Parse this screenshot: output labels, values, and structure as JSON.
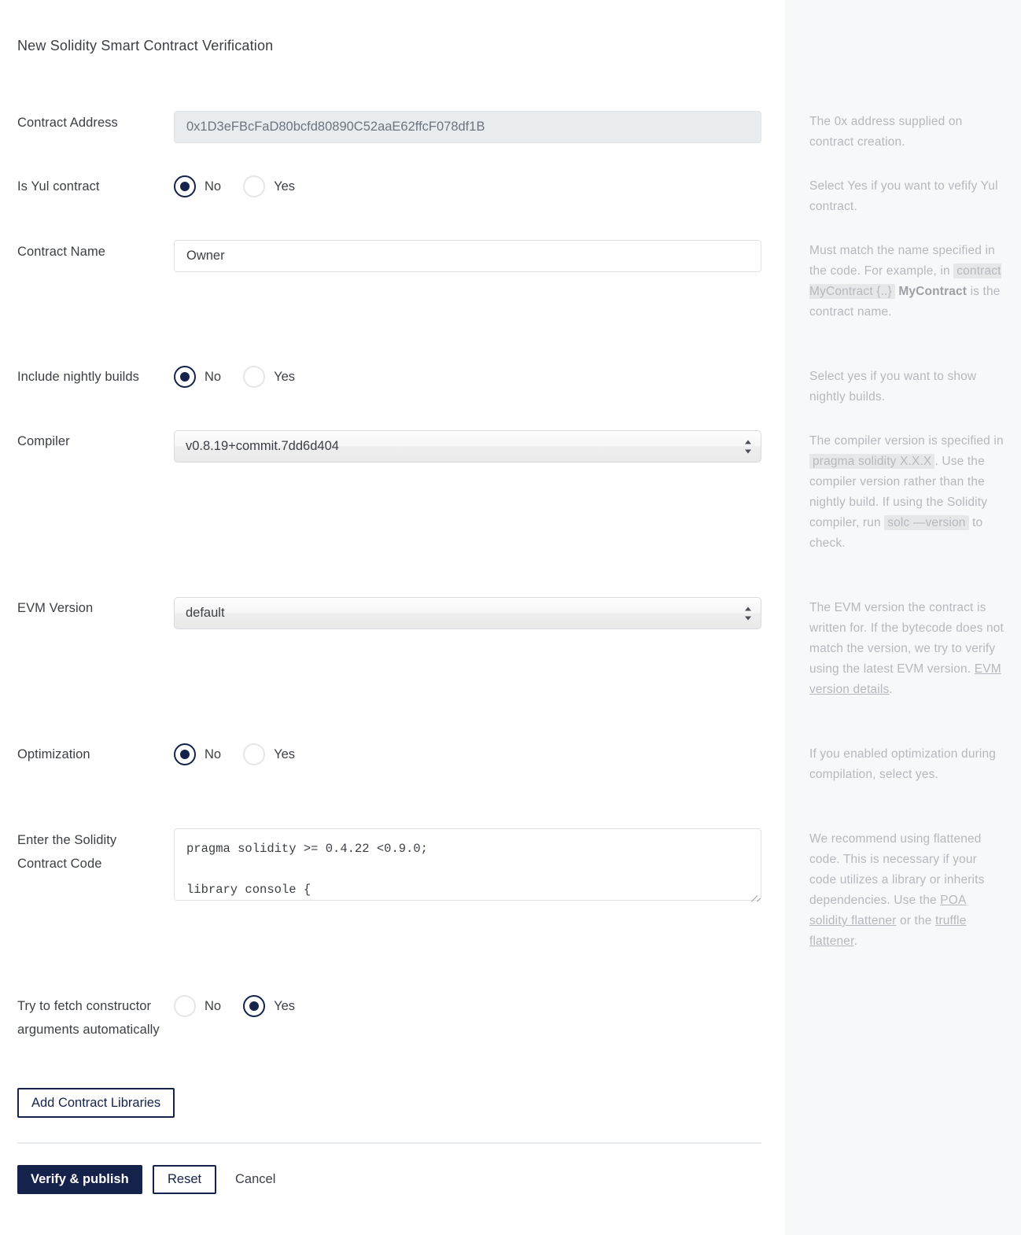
{
  "page": {
    "title": "New Solidity Smart Contract Verification"
  },
  "fields": {
    "contract_address": {
      "label": "Contract Address",
      "value": "0x1D3eFBcFaD80bcfd80890C52aaE62ffcF078df1B"
    },
    "is_yul": {
      "label": "Is Yul contract",
      "no": "No",
      "yes": "Yes",
      "selected": "No"
    },
    "contract_name": {
      "label": "Contract Name",
      "value": "Owner"
    },
    "nightly_builds": {
      "label": "Include nightly builds",
      "no": "No",
      "yes": "Yes",
      "selected": "No"
    },
    "compiler": {
      "label": "Compiler",
      "value": "v0.8.19+commit.7dd6d404"
    },
    "evm_version": {
      "label": "EVM Version",
      "value": "default"
    },
    "optimization": {
      "label": "Optimization",
      "no": "No",
      "yes": "Yes",
      "selected": "No"
    },
    "contract_code": {
      "label": "Enter the Solidity Contract Code",
      "value": "pragma solidity >= 0.4.22 <0.9.0;\n\nlibrary console {"
    },
    "constructor_args": {
      "label": "Try to fetch constructor arguments automatically",
      "no": "No",
      "yes": "Yes",
      "selected": "Yes"
    }
  },
  "buttons": {
    "add_libraries": "Add Contract Libraries",
    "verify": "Verify & publish",
    "reset": "Reset",
    "cancel": "Cancel"
  },
  "help": {
    "address": "The 0x address supplied on contract creation.",
    "yul": "Select Yes if you want to vefify Yul contract.",
    "name_pre": "Must match the name specified in the code. For example, in ",
    "name_code1": "contract MyContract {..}",
    "name_bold": "MyContract",
    "name_post": " is the contract name.",
    "nightly": "Select yes if you want to show nightly builds.",
    "compiler_pre": "The compiler version is specified in ",
    "compiler_code1": "pragma solidity X.X.X",
    "compiler_mid": ". Use the compiler version rather than the nightly build. If using the Solidity compiler, run ",
    "compiler_code2": "solc —version",
    "compiler_post": " to check.",
    "evm_pre": "The EVM version the contract is written for. If the bytecode does not match the version, we try to verify using the latest EVM version. ",
    "evm_link": "EVM version details",
    "evm_post": ".",
    "optimization": "If you enabled optimization during compilation, select yes.",
    "code_pre": "We recommend using flattened code. This is necessary if your code utilizes a library or inherits dependencies. Use the ",
    "code_link1": "POA solidity flattener",
    "code_mid": " or the ",
    "code_link2": "truffle flattener",
    "code_post": "."
  },
  "colors": {
    "navy": "#15224b",
    "label_text": "#3b3f45",
    "help_text": "#b4b9bf",
    "panel_bg": "#f7f8f9",
    "readonly_bg": "#e9ecef"
  }
}
